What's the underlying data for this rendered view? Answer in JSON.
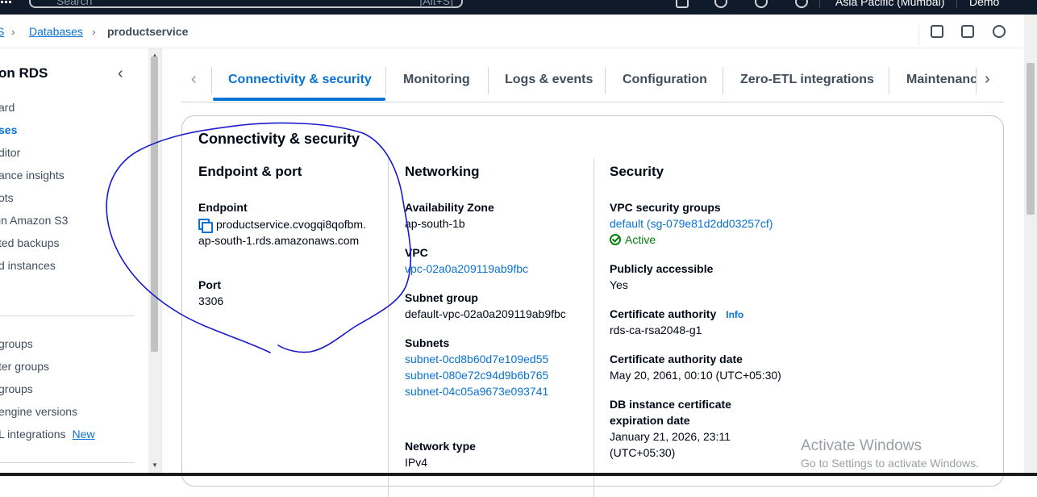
{
  "topbar": {
    "search_placeholder": "Search",
    "search_shortcut": "[Alt+S]",
    "region": "Asia Pacific (Mumbai)",
    "account": "Demo"
  },
  "breadcrumb": {
    "first": "S",
    "databases": "Databases",
    "current": "productservice"
  },
  "sidebar": {
    "title": "on RDS",
    "items": [
      {
        "label": "ard",
        "active": false
      },
      {
        "label": "ses",
        "active": true
      },
      {
        "label": "ditor",
        "active": false
      },
      {
        "label": "ance insights",
        "active": false
      },
      {
        "label": "ots",
        "active": false
      },
      {
        "label": "in Amazon S3",
        "active": false
      },
      {
        "label": "ted backups",
        "active": false
      },
      {
        "label": "d instances",
        "active": false
      }
    ],
    "items2": [
      {
        "label": "groups"
      },
      {
        "label": "ter groups"
      },
      {
        "label": "groups"
      },
      {
        "label": "engine versions"
      },
      {
        "label": "L integrations",
        "badge": "New"
      }
    ]
  },
  "tabs": [
    {
      "label": "Connectivity & security",
      "active": true
    },
    {
      "label": "Monitoring"
    },
    {
      "label": "Logs & events"
    },
    {
      "label": "Configuration"
    },
    {
      "label": "Zero-ETL integrations"
    },
    {
      "label": "Maintenanc"
    }
  ],
  "panel": {
    "title": "Connectivity & security",
    "endpoint_port": {
      "heading": "Endpoint & port",
      "endpoint_label": "Endpoint",
      "endpoint_value": "productservice.cvogqi8qofbm.ap-south-1.rds.amazonaws.com",
      "port_label": "Port",
      "port_value": "3306"
    },
    "networking": {
      "heading": "Networking",
      "az_label": "Availability Zone",
      "az_value": "ap-south-1b",
      "vpc_label": "VPC",
      "vpc_value": "vpc-02a0a209119ab9fbc",
      "subnet_group_label": "Subnet group",
      "subnet_group_value": "default-vpc-02a0a209119ab9fbc",
      "subnets_label": "Subnets",
      "subnets": [
        "subnet-0cd8b60d7e109ed55",
        "subnet-080e72c94d9b6b765",
        "subnet-04c05a9673e093741"
      ],
      "network_type_label": "Network type",
      "network_type_value": "IPv4"
    },
    "security": {
      "heading": "Security",
      "sg_label": "VPC security groups",
      "sg_value": "default (sg-079e81d2dd03257cf)",
      "sg_status": "Active",
      "public_label": "Publicly accessible",
      "public_value": "Yes",
      "ca_label": "Certificate authority",
      "ca_info": "Info",
      "ca_value": "rds-ca-rsa2048-g1",
      "ca_date_label": "Certificate authority date",
      "ca_date_value": "May 20, 2061, 00:10 (UTC+05:30)",
      "cert_exp_label_1": "DB instance certificate",
      "cert_exp_label_2": "expiration date",
      "cert_exp_value_1": "January 21, 2026, 23:11",
      "cert_exp_value_2": "(UTC+05:30)"
    }
  },
  "watermark": {
    "line1": "Activate Windows",
    "line2": "Go to Settings to activate Windows."
  },
  "colors": {
    "link": "#0972d3",
    "active_status": "#037f0c",
    "annotation_ink": "#1a1acc"
  }
}
